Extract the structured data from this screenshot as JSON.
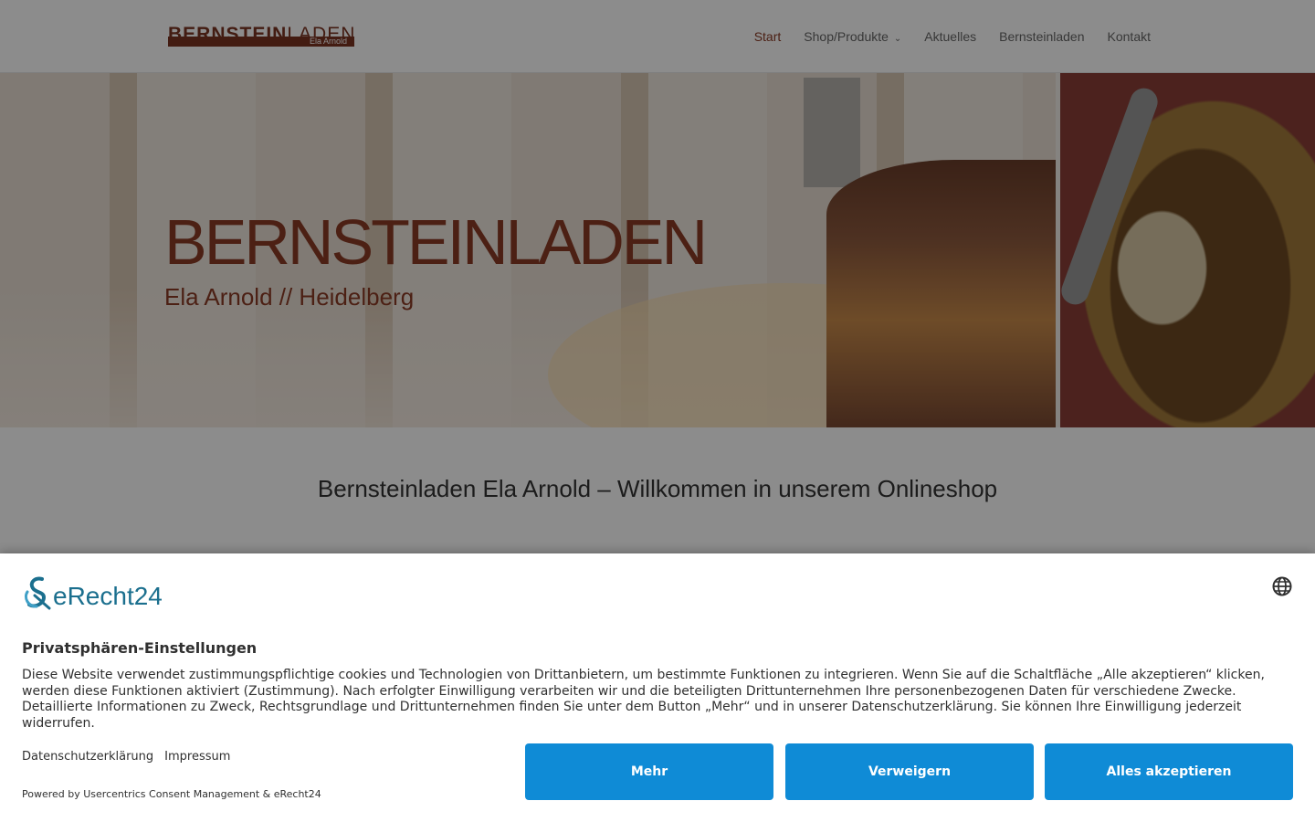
{
  "header": {
    "logo": {
      "main_bold": "BERNSTEIN",
      "main_light": "LADEN",
      "sub": "Ela Arnold"
    },
    "nav": [
      {
        "label": "Start",
        "active": true
      },
      {
        "label": "Shop/Produkte",
        "has_dropdown": true
      },
      {
        "label": "Aktuelles"
      },
      {
        "label": "Bernsteinladen"
      },
      {
        "label": "Kontakt"
      }
    ]
  },
  "hero": {
    "title": "BERNSTEINLADEN",
    "subtitle": "Ela Arnold // Heidelberg"
  },
  "welcome": "Bernsteinladen Ela Arnold – Willkommen in unserem Onlineshop",
  "consent": {
    "brand": "eRecht24",
    "language_icon": "globe-icon",
    "title": "Privatsphären-Einstellungen",
    "text": "Diese Website verwendet zustimmungspflichtige cookies und Technologien von Drittanbietern, um bestimmte Funktionen zu integrieren. Wenn Sie auf die Schaltfläche „Alle akzeptieren“ klicken, werden diese Funktionen aktiviert (Zustimmung). Nach erfolgter Einwilligung verarbeiten wir und die beteiligten Drittunternehmen Ihre personenbezogenen Daten für verschiedene Zwecke. Detaillierte Informationen zu Zweck, Rechtsgrundlage und Drittunternehmen finden Sie unter dem Button „Mehr“ und in unserer Datenschutzerklärung. Sie können Ihre Einwilligung jederzeit widerrufen.",
    "links": {
      "privacy": "Datenschutzerklärung",
      "imprint": "Impressum"
    },
    "powered_by": "Powered by Usercentrics Consent Management & eRecht24",
    "buttons": {
      "more": "Mehr",
      "deny": "Verweigern",
      "accept": "Alles akzeptieren"
    }
  },
  "colors": {
    "brand": "#8a3b26",
    "button": "#0f8bd6",
    "erecht_blue": "#1b6f8e"
  }
}
